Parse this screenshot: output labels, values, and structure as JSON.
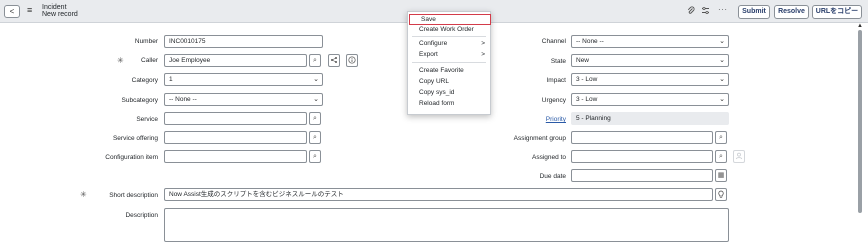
{
  "header": {
    "back_glyph": "<",
    "menu_glyph": "≡",
    "title_line1": "Incident",
    "title_line2": "New record",
    "buttons": {
      "submit": "Submit",
      "resolve": "Resolve",
      "copy": "URLをコピー"
    }
  },
  "context_menu": {
    "items": {
      "save": "Save",
      "create_work_order": "Create Work Order",
      "configure": "Configure",
      "export": "Export",
      "create_favorite": "Create Favorite",
      "copy_url": "Copy URL",
      "copy_sys_id": "Copy sys_id",
      "reload_form": "Reload form"
    },
    "submenu_arrow": ">"
  },
  "form": {
    "number": {
      "label": "Number",
      "value": "INC0010175"
    },
    "caller": {
      "label": "Caller",
      "value": "Joe Employee"
    },
    "category": {
      "label": "Category",
      "value": "1"
    },
    "subcategory": {
      "label": "Subcategory",
      "value": "-- None --"
    },
    "service": {
      "label": "Service",
      "value": ""
    },
    "service_offering": {
      "label": "Service offering",
      "value": ""
    },
    "configuration_item": {
      "label": "Configuration item",
      "value": ""
    },
    "channel": {
      "label": "Channel",
      "value": "-- None --"
    },
    "state": {
      "label": "State",
      "value": "New"
    },
    "impact": {
      "label": "Impact",
      "value": "3 - Low"
    },
    "urgency": {
      "label": "Urgency",
      "value": "3 - Low"
    },
    "priority": {
      "label": "Priority",
      "value": "5 - Planning"
    },
    "assignment_group": {
      "label": "Assignment group",
      "value": ""
    },
    "assigned_to": {
      "label": "Assigned to",
      "value": ""
    },
    "due_date": {
      "label": "Due date",
      "value": ""
    },
    "short_description": {
      "label": "Short description",
      "value": "Now Assist生成のスクリプトを含むビジネスルールのテスト"
    },
    "description": {
      "label": "Description",
      "value": ""
    }
  },
  "glyphs": {
    "required": "✳",
    "search": "⌕",
    "chevron_down": "⌄",
    "calendar": "▦",
    "lightbulb": "♀"
  }
}
